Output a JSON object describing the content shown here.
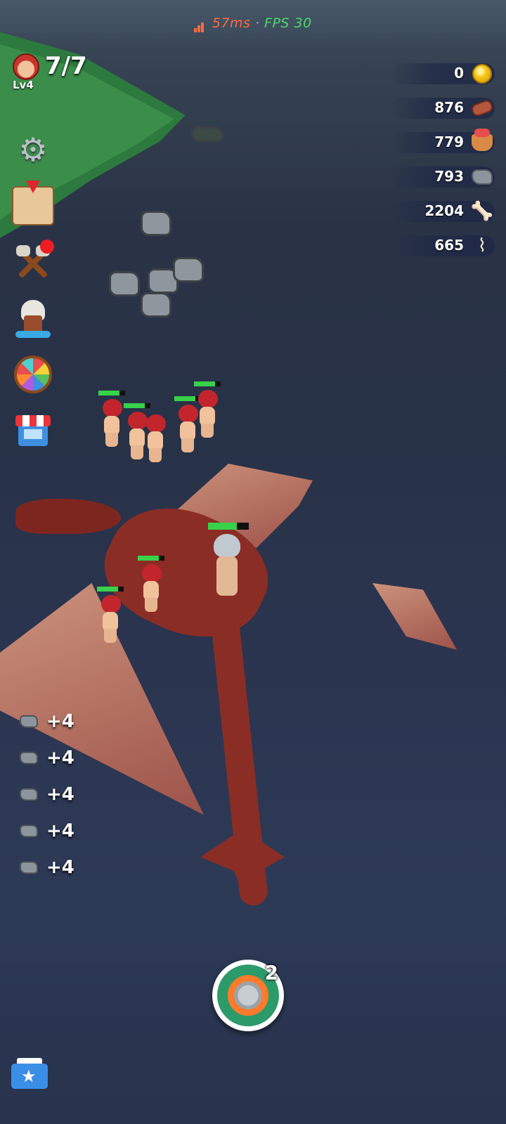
{
  "status": {
    "ping": "57ms",
    "separator": "·",
    "fps": "FPS 30"
  },
  "player": {
    "level": "Lv4",
    "troops": "7/7"
  },
  "resources": [
    {
      "name": "coin",
      "value": "0"
    },
    {
      "name": "meat",
      "value": "876"
    },
    {
      "name": "food-basket",
      "value": "779"
    },
    {
      "name": "stone",
      "value": "793"
    },
    {
      "name": "bone",
      "value": "2204"
    },
    {
      "name": "tooth",
      "value": "665"
    }
  ],
  "side_menu": [
    "settings",
    "treasure-map",
    "crafting",
    "dungeon",
    "lucky-wheel",
    "shop"
  ],
  "gains": [
    {
      "resource": "stone",
      "text": "+4"
    },
    {
      "resource": "stone",
      "text": "+4"
    },
    {
      "resource": "stone",
      "text": "+4"
    },
    {
      "resource": "stone",
      "text": "+4"
    },
    {
      "resource": "stone",
      "text": "+4"
    }
  ],
  "action": {
    "item": "canned-food",
    "count": "2"
  },
  "mail": {
    "icon": "mail-star-icon"
  }
}
